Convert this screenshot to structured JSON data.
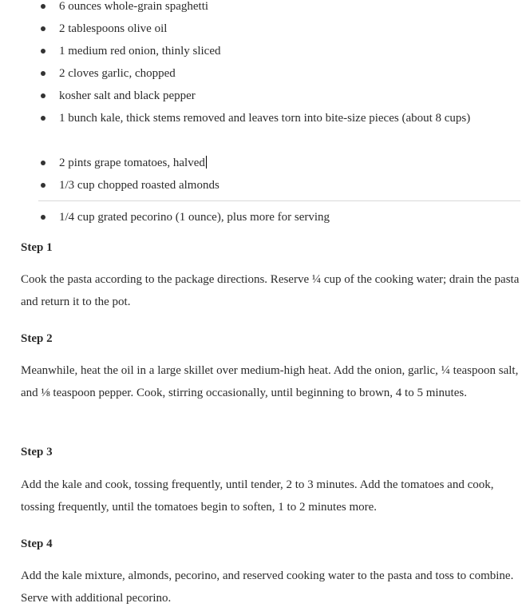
{
  "ingredients": [
    "6 ounces whole-grain spaghetti",
    "2 tablespoons olive oil",
    "1 medium red onion, thinly sliced",
    "2 cloves garlic, chopped",
    "kosher salt and black pepper",
    "1 bunch kale, thick stems removed and leaves torn into bite-size pieces (about 8 cups)",
    "2 pints grape tomatoes, halved",
    "1/3 cup chopped roasted almonds",
    "1/4 cup grated pecorino (1 ounce), plus more for serving"
  ],
  "steps": [
    {
      "heading": "Step 1",
      "text": "Cook the pasta according to the package directions. Reserve ¼ cup of the cooking water; drain the pasta and return it to the pot."
    },
    {
      "heading": "Step 2",
      "text": "Meanwhile, heat the oil in a large skillet over medium-high heat. Add the onion, garlic, ¼ teaspoon salt, and ⅛ teaspoon pepper. Cook, stirring occasionally, until beginning to brown, 4 to 5 minutes."
    },
    {
      "heading": "Step 3",
      "text": "Add the kale and cook, tossing frequently, until tender, 2 to 3 minutes. Add the tomatoes and cook, tossing frequently, until the tomatoes begin to soften, 1 to 2 minutes more."
    },
    {
      "heading": "Step 4",
      "text": "Add the kale mixture, almonds, pecorino, and reserved cooking water to the pasta and toss to combine. Serve with additional pecorino."
    }
  ]
}
